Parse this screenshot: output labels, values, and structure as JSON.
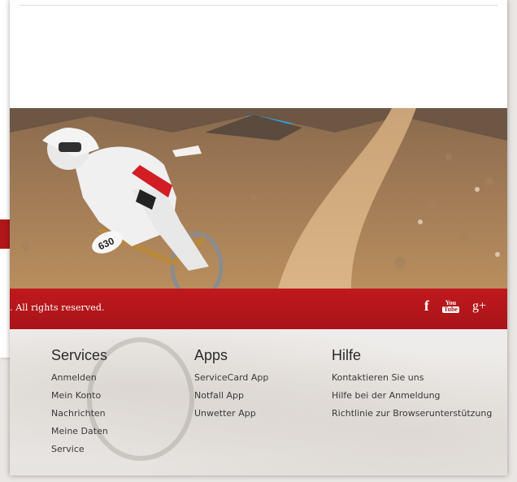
{
  "footer_bar": {
    "copyright": ". All rights reserved.",
    "social": [
      {
        "icon": "facebook-icon",
        "glyph": "f"
      },
      {
        "icon": "youtube-icon",
        "glyph_top": "You",
        "glyph_bottom": "Tube"
      },
      {
        "icon": "google-plus-icon",
        "glyph": "g+"
      }
    ]
  },
  "footer": {
    "columns": [
      {
        "title": "Services",
        "links": [
          "Anmelden",
          "Mein Konto",
          "Nachrichten",
          "Meine Daten",
          "Service"
        ]
      },
      {
        "title": "Apps",
        "links": [
          "ServiceCard App",
          "Notfall App",
          "Unwetter App"
        ]
      },
      {
        "title": "Hilfe",
        "links": [
          "Kontaktieren Sie uns",
          "Hilfe bei der Anmeldung",
          "Richtlinie zur Browserunterstützung"
        ]
      }
    ]
  },
  "colors": {
    "brand_red": "#b0171b",
    "sky": "#2aa7e8"
  },
  "hero": {
    "bib_number": "630"
  }
}
